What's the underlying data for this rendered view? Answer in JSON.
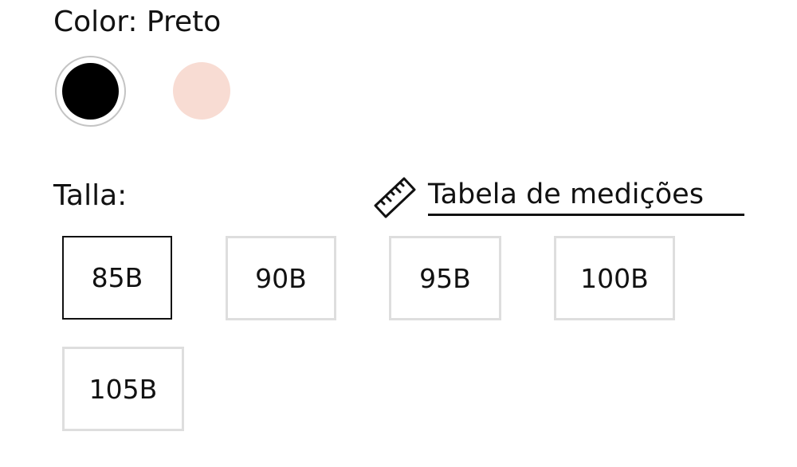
{
  "color": {
    "label": "Color: Preto",
    "swatches": [
      {
        "name": "Preto",
        "hex": "#000000",
        "selected": true
      },
      {
        "name": "Rosa",
        "hex": "#f8dcd3",
        "selected": false
      }
    ]
  },
  "size": {
    "label": "Talla:",
    "measure_link": "Tabela de medições",
    "measure_icon": "ruler-icon",
    "options": [
      "85B",
      "90B",
      "95B",
      "100B",
      "105B"
    ],
    "selected": "85B"
  }
}
